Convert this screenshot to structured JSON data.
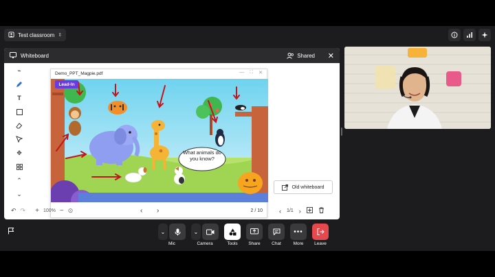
{
  "header": {
    "classroom": "Test classroom"
  },
  "whiteboard": {
    "title": "Whiteboard",
    "shared_label": "Shared",
    "doc_title": "Demo_PPT_Magpie.pdf",
    "slide_tag": "Lead-In",
    "slide_question": "What animals do you know?",
    "zoom": "100%",
    "page_indicator": "2 / 10",
    "old_whiteboard_label": "Old whiteboard",
    "board_page": "1/1"
  },
  "controls": {
    "mic": "Mic",
    "camera": "Camera",
    "tools": "Tools",
    "share": "Share",
    "chat": "Chat",
    "more": "More",
    "leave": "Leave"
  },
  "colors": {
    "leave": "#e5484d",
    "accent": "#2a6be0",
    "tag": "#6a3be0"
  }
}
